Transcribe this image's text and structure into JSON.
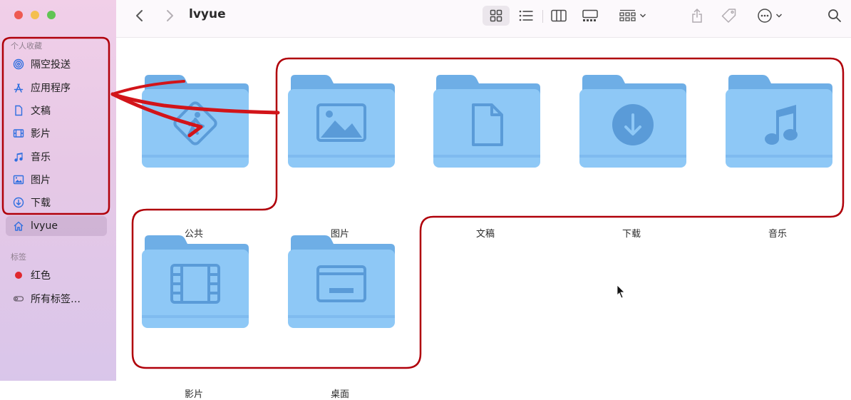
{
  "window": {
    "title": "lvyue"
  },
  "sidebar": {
    "favorites_label": "个人收藏",
    "tags_label": "标签",
    "items": [
      {
        "label": "隔空投送",
        "icon": "airdrop-icon"
      },
      {
        "label": "应用程序",
        "icon": "applications-icon"
      },
      {
        "label": "文稿",
        "icon": "document-icon"
      },
      {
        "label": "影片",
        "icon": "film-icon"
      },
      {
        "label": "音乐",
        "icon": "music-note-icon"
      },
      {
        "label": "图片",
        "icon": "photo-icon"
      },
      {
        "label": "下载",
        "icon": "download-icon"
      },
      {
        "label": "lvyue",
        "icon": "home-icon",
        "selected": true
      }
    ],
    "tags": [
      {
        "label": "红色",
        "color": "#e0282e"
      },
      {
        "label": "所有标签…"
      }
    ]
  },
  "folders": [
    {
      "label": "公共",
      "icon": "public-walker-icon"
    },
    {
      "label": "图片",
      "icon": "photo-icon"
    },
    {
      "label": "文稿",
      "icon": "document-icon"
    },
    {
      "label": "下载",
      "icon": "download-icon"
    },
    {
      "label": "音乐",
      "icon": "music-note-icon"
    },
    {
      "label": "影片",
      "icon": "film-icon"
    },
    {
      "label": "桌面",
      "icon": "desktop-icon"
    }
  ],
  "colors": {
    "folder": "#8ec8f6",
    "folder_tab": "#6eaee6",
    "folder_symbol": "#5a9bd8",
    "annotation": "#b0000a"
  }
}
